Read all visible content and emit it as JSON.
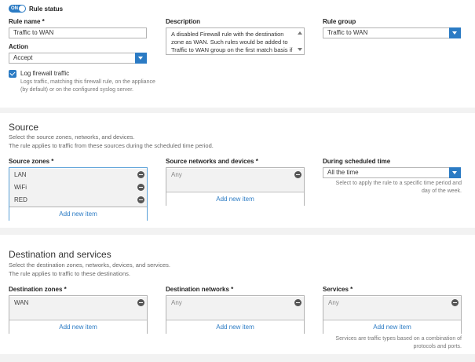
{
  "general": {
    "rule_status_label": "Rule status",
    "toggle_text": "ON",
    "rule_name_label": "Rule name *",
    "rule_name_value": "Traffic to WAN",
    "description_label": "Description",
    "description_value": "A disabled Firewall rule with the destination zone as WAN. Such rules would be added to Traffic to WAN group on the first match basis if",
    "rule_group_label": "Rule group",
    "rule_group_value": "Traffic to WAN",
    "action_label": "Action",
    "action_value": "Accept",
    "log_label": "Log firewall traffic",
    "log_hint": "Logs traffic, matching this firewall rule, on the appliance (by default) or on the configured syslog server."
  },
  "source": {
    "title": "Source",
    "desc1": "Select the source zones, networks, and devices.",
    "desc2": "The rule applies to traffic from these sources during the scheduled time period.",
    "zones_label": "Source zones *",
    "zones": [
      "LAN",
      "WiFi",
      "RED"
    ],
    "networks_label": "Source networks and devices *",
    "networks": [
      "Any"
    ],
    "schedule_label": "During scheduled time",
    "schedule_value": "All the time",
    "schedule_hint": "Select to apply the rule to a specific time period and day of the week.",
    "add_new": "Add new item"
  },
  "destination": {
    "title": "Destination and services",
    "desc1": "Select the destination zones, networks, devices, and services.",
    "desc2": "The rule applies to traffic to these destinations.",
    "zones_label": "Destination zones *",
    "zones": [
      "WAN"
    ],
    "networks_label": "Destination networks *",
    "networks": [
      "Any"
    ],
    "services_label": "Services *",
    "services": [
      "Any"
    ],
    "services_hint": "Services are traffic types based on a combination of protocols and ports.",
    "add_new": "Add new item"
  }
}
